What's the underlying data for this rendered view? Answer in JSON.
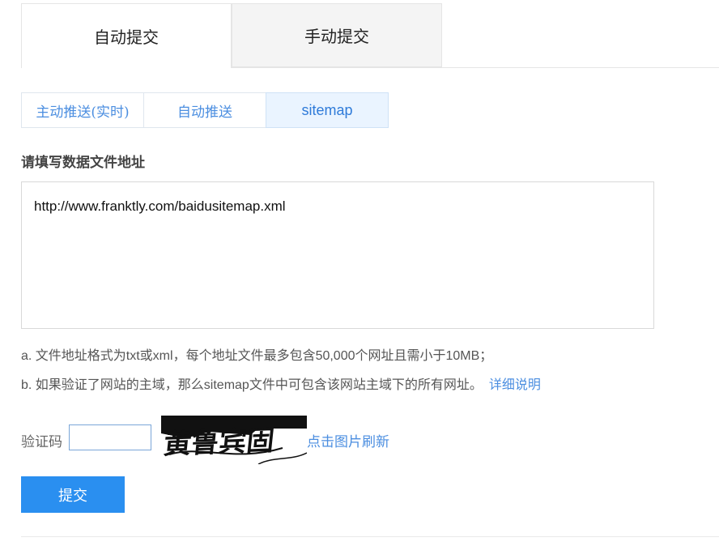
{
  "top_tabs": [
    {
      "label": "自动提交",
      "active": true
    },
    {
      "label": "手动提交",
      "active": false
    }
  ],
  "sub_tabs": [
    {
      "label": "主动推送(实时)",
      "active": false
    },
    {
      "label": "自动推送",
      "active": false
    },
    {
      "label": "sitemap",
      "active": true
    }
  ],
  "form": {
    "label": "请填写数据文件地址",
    "url_value": "http://www.franktly.com/baidusitemap.xml"
  },
  "notes": {
    "line_a": "a. 文件地址格式为txt或xml，每个地址文件最多包含50,000个网址且需小于10MB；",
    "line_b": "b. 如果验证了网站的主域，那么sitemap文件中可包含该网站主域下的所有网址。",
    "detail_link": "详细说明"
  },
  "captcha": {
    "label": "验证码",
    "input_value": "",
    "image_text": "黄鲁宾固",
    "refresh_label": "点击图片刷新"
  },
  "submit_label": "提交"
}
